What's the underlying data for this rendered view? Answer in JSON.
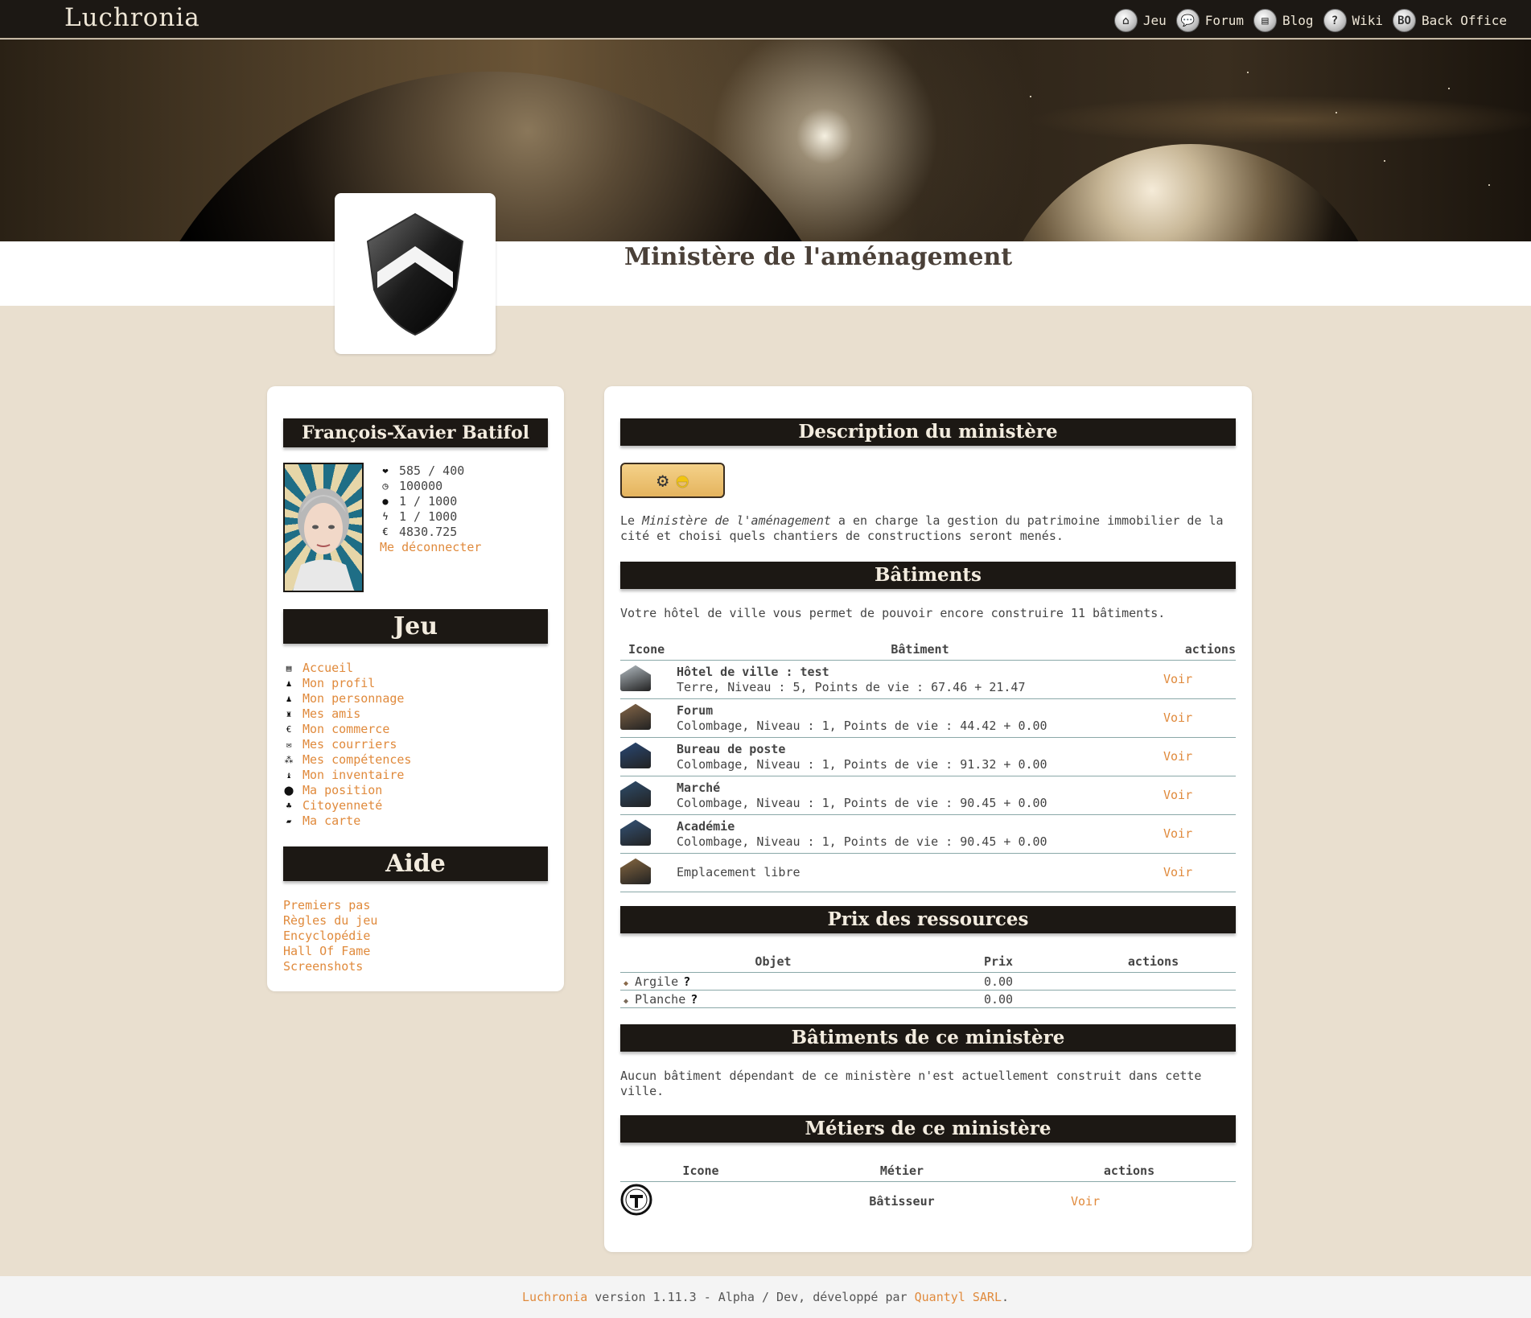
{
  "header": {
    "logo": "Luchronia",
    "nav": [
      {
        "label": "Jeu",
        "icon": "home-icon"
      },
      {
        "label": "Forum",
        "icon": "speech-bubble-icon"
      },
      {
        "label": "Blog",
        "icon": "book-icon"
      },
      {
        "label": "Wiki",
        "icon": "question-icon"
      },
      {
        "label": "Back Office",
        "icon": "bo-icon"
      }
    ]
  },
  "page": {
    "title": "Ministère de l'aménagement"
  },
  "character": {
    "name": "François-Xavier Batifol",
    "stats": [
      {
        "icon": "heart-icon",
        "value": "585 / 400"
      },
      {
        "icon": "clock-icon",
        "value": "100000"
      },
      {
        "icon": "drop-icon",
        "value": "1 / 1000"
      },
      {
        "icon": "lightning-icon",
        "value": "1 / 1000"
      },
      {
        "icon": "euro-icon",
        "value": "4830.725"
      }
    ],
    "logout": "Me déconnecter"
  },
  "jeu": {
    "title": "Jeu",
    "items": [
      {
        "label": "Accueil",
        "icon": "list-icon"
      },
      {
        "label": "Mon profil",
        "icon": "person-icon"
      },
      {
        "label": "Mon personnage",
        "icon": "person-icon"
      },
      {
        "label": "Mes amis",
        "icon": "friends-icon"
      },
      {
        "label": "Mon commerce",
        "icon": "euro-icon"
      },
      {
        "label": "Mes courriers",
        "icon": "mail-icon"
      },
      {
        "label": "Mes compétences",
        "icon": "skills-icon"
      },
      {
        "label": "Mon inventaire",
        "icon": "bag-icon"
      },
      {
        "label": "Ma position",
        "icon": "pin-icon"
      },
      {
        "label": "Citoyenneté",
        "icon": "citizen-icon"
      },
      {
        "label": "Ma carte",
        "icon": "map-icon"
      }
    ]
  },
  "aide": {
    "title": "Aide",
    "items": [
      "Premiers pas",
      "Règles du jeu",
      "Encyclopédie",
      "Hall Of Fame",
      "Screenshots"
    ]
  },
  "main": {
    "description": {
      "title": "Description du ministère",
      "text_pre": "Le ",
      "text_em": "Ministère de l'aménagement",
      "text_post": " a en charge la gestion du patrimoine immobilier de la cité et choisi quels chantiers de constructions seront menés."
    },
    "batiments": {
      "title": "Bâtiments",
      "intro": "Votre hôtel de ville vous permet de pouvoir encore construire 11 bâtiments.",
      "columns": [
        "Icone",
        "Bâtiment",
        "actions"
      ],
      "rows": [
        {
          "name": "Hôtel de ville : test",
          "details": "Terre, Niveau : 5, Points de vie : 67.46 + 21.47",
          "action": "Voir",
          "color": "#b9c2c8"
        },
        {
          "name": "Forum",
          "details": "Colombage, Niveau : 1, Points de vie : 44.42 + 0.00",
          "action": "Voir",
          "color": "#8a6a4a"
        },
        {
          "name": "Bureau de poste",
          "details": "Colombage, Niveau : 1, Points de vie : 91.32 + 0.00",
          "action": "Voir",
          "color": "#2a4a78"
        },
        {
          "name": "Marché",
          "details": "Colombage, Niveau : 1, Points de vie : 90.45 + 0.00",
          "action": "Voir",
          "color": "#2f4f6f"
        },
        {
          "name": "Académie",
          "details": "Colombage, Niveau : 1, Points de vie : 90.45 + 0.00",
          "action": "Voir",
          "color": "#35557a"
        },
        {
          "name": "",
          "details": "Emplacement libre",
          "action": "Voir",
          "color": "#8a6a42"
        }
      ]
    },
    "prix": {
      "title": "Prix des ressources",
      "columns": [
        "Objet",
        "Prix",
        "actions"
      ],
      "rows": [
        {
          "name": "Argile",
          "price": "0.00"
        },
        {
          "name": "Planche",
          "price": "0.00"
        }
      ]
    },
    "batiments_ministere": {
      "title": "Bâtiments de ce ministère",
      "text": "Aucun bâtiment dépendant de ce ministère n'est actuellement construit dans cette ville."
    },
    "metiers": {
      "title": "Métiers de ce ministère",
      "columns": [
        "Icone",
        "Métier",
        "actions"
      ],
      "rows": [
        {
          "name": "Bâtisseur",
          "action": "Voir"
        }
      ]
    }
  },
  "footer": {
    "brand": "Luchronia",
    "middle": " version 1.11.3 - Alpha / Dev, développé par ",
    "company": "Quantyl SARL",
    "end": "."
  }
}
